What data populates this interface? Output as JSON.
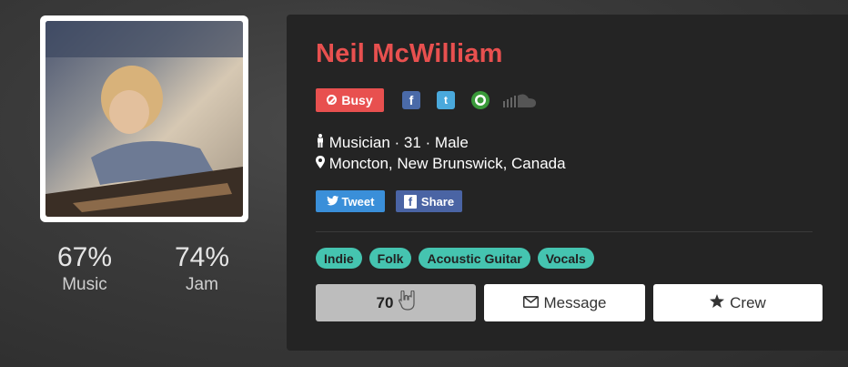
{
  "profile": {
    "name": "Neil McWilliam",
    "status": "Busy",
    "details": "Musician · 31 · Male",
    "location": "Moncton, New Brunswick, Canada"
  },
  "stats": {
    "music_pct": "67%",
    "music_label": "Music",
    "jam_pct": "74%",
    "jam_label": "Jam"
  },
  "social_icons": [
    "facebook-icon",
    "twitter-icon",
    "reverbnation-icon",
    "soundcloud-icon"
  ],
  "share": {
    "tweet_label": "Tweet",
    "share_label": "Share"
  },
  "tags": [
    "Indie",
    "Folk",
    "Acoustic Guitar",
    "Vocals"
  ],
  "actions": {
    "jam_count": "70",
    "message_label": "Message",
    "crew_label": "Crew"
  },
  "colors": {
    "accent": "#e8504f",
    "tag": "#45c4b0",
    "card_bg": "#242424"
  }
}
